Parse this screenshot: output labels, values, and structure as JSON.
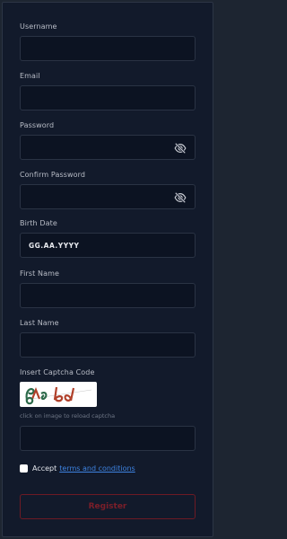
{
  "form": {
    "username_label": "Username",
    "email_label": "Email",
    "password_label": "Password",
    "confirm_password_label": "Confirm Password",
    "birth_date_label": "Birth Date",
    "birth_date_placeholder": "GG.AA.YYYY",
    "first_name_label": "First Name",
    "last_name_label": "Last Name",
    "captcha_label": "Insert Captcha Code",
    "captcha_hint": "click on image to reload captcha",
    "accept_text": "Accept",
    "terms_link": "terms and conditions",
    "register_label": "Register"
  },
  "icons": {
    "password_toggle": "eye-slash-icon"
  },
  "colors": {
    "background": "#121a2b",
    "field_bg": "#0c1322",
    "link": "#3d82e0",
    "register_border": "#6d1a24",
    "register_text": "#7c1e29"
  }
}
